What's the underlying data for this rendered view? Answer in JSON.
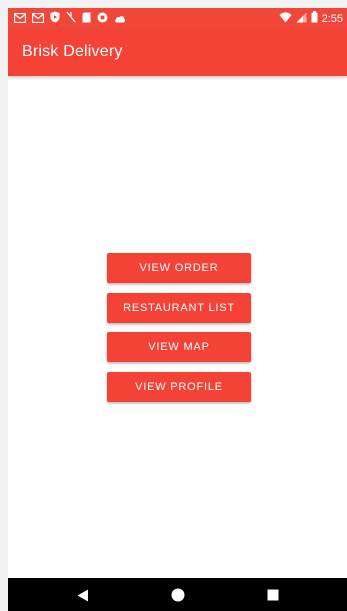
{
  "status_bar": {
    "time": "2:55",
    "notification_icons": [
      "mail-icon",
      "mail-icon",
      "shield-icon",
      "signal-off-icon",
      "sim-icon",
      "record-icon",
      "cloud-icon"
    ],
    "right_icons": [
      "wifi-icon",
      "cell-signal-icon",
      "battery-icon"
    ],
    "color": "#f0473a"
  },
  "app_bar": {
    "title": "Brisk Delivery",
    "color": "#f44336"
  },
  "main": {
    "buttons": [
      {
        "label": "VIEW ORDER"
      },
      {
        "label": "RESTAURANT LIST"
      },
      {
        "label": "VIEW MAP"
      },
      {
        "label": "VIEW PROFILE"
      }
    ],
    "button_color": "#f44336"
  },
  "nav_bar": {
    "items": [
      "back-icon",
      "home-icon",
      "recents-icon"
    ]
  }
}
